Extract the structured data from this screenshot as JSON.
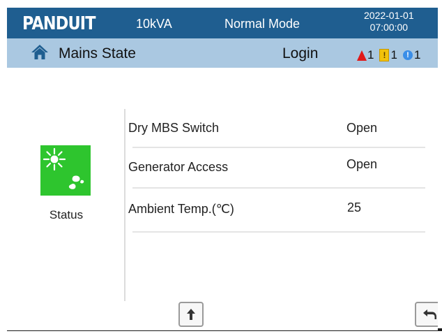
{
  "header": {
    "logo": "PANDUIT",
    "capacity": "10kVA",
    "mode": "Normal Mode",
    "date": "2022-01-01",
    "time": "07:00:00"
  },
  "statusbar": {
    "home_icon": "home-icon",
    "title": "Mains State",
    "login_label": "Login",
    "alarms": [
      {
        "type": "critical",
        "icon": "warning-triangle-icon",
        "count": "1",
        "color": "#e01919"
      },
      {
        "type": "warning",
        "icon": "exclamation-badge-icon",
        "count": "1",
        "color": "#f2c20a"
      },
      {
        "type": "info",
        "icon": "info-circle-icon",
        "count": "1",
        "color": "#3a8ee8"
      }
    ]
  },
  "status_tile": {
    "icon": "sun-rain-icon",
    "label": "Status",
    "color": "#2ec52e"
  },
  "rows": [
    {
      "label": "Dry MBS Switch",
      "value": "Open"
    },
    {
      "label": "Generator Access",
      "value": "Open"
    },
    {
      "label": "Ambient Temp.(℃)",
      "value": "25"
    }
  ],
  "footer": {
    "up_icon": "arrow-up-icon",
    "back_icon": "return-arrow-icon"
  },
  "colors": {
    "header_bg": "#1f5e90",
    "statusbar_bg": "#aac8e1"
  }
}
